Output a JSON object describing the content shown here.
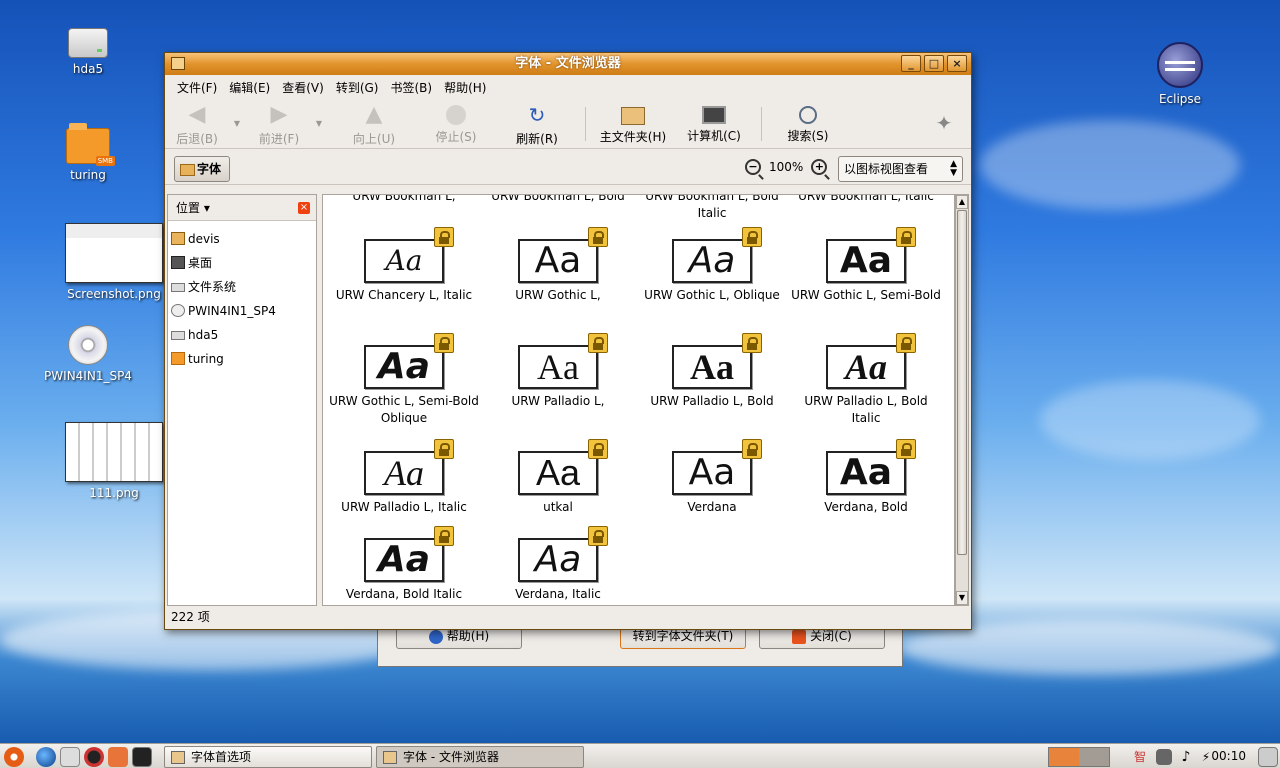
{
  "desktop": {
    "icons": [
      {
        "label": "hda5"
      },
      {
        "label": "turing",
        "badge": "SMB"
      },
      {
        "label": "Screenshot.png"
      },
      {
        "label": "PWIN4IN1_SP4"
      },
      {
        "label": "111.png"
      },
      {
        "label": "Eclipse"
      }
    ]
  },
  "background_dialog": {
    "help_label": "帮助(H)",
    "goto_label": "转到字体文件夹(T)",
    "close_label": "关闭(C)"
  },
  "window": {
    "title": "字体 - 文件浏览器",
    "controls": {
      "minimize": "_",
      "maximize": "□",
      "close": "×"
    },
    "menu": [
      "文件(F)",
      "编辑(E)",
      "查看(V)",
      "转到(G)",
      "书签(B)",
      "帮助(H)"
    ],
    "toolbar": {
      "back": "后退(B)",
      "forward": "前进(F)",
      "up": "向上(U)",
      "stop": "停止(S)",
      "reload": "刷新(R)",
      "home": "主文件夹(H)",
      "computer": "计算机(C)",
      "search": "搜索(S)"
    },
    "location": {
      "crumb": "字体",
      "zoom": "100%",
      "zoom_out": "−",
      "zoom_in": "+",
      "view_mode": "以图标视图查看"
    },
    "sidebar": {
      "header": "位置",
      "close": "×",
      "items": [
        "devis",
        "桌面",
        "文件系统",
        "PWIN4IN1_SP4",
        "hda5",
        "turing"
      ]
    },
    "top_row": [
      "URW Bookman L,",
      "URW Bookman L, Bold",
      "URW Bookman L, Bold Italic",
      "URW Bookman L, Italic"
    ],
    "fonts": [
      {
        "name": "URW Chancery L, Italic",
        "glyph": "Aa"
      },
      {
        "name": "URW Gothic L,",
        "glyph": "Aa"
      },
      {
        "name": "URW Gothic L, Oblique",
        "glyph": "Aa"
      },
      {
        "name": "URW Gothic L, Semi-Bold",
        "glyph": "Aa"
      },
      {
        "name": "URW Gothic L, Semi-Bold Oblique",
        "glyph": "Aa"
      },
      {
        "name": "URW Palladio L,",
        "glyph": "Aa"
      },
      {
        "name": "URW Palladio L, Bold",
        "glyph": "Aa"
      },
      {
        "name": "URW Palladio L, Bold Italic",
        "glyph": "Aa"
      },
      {
        "name": "URW Palladio L, Italic",
        "glyph": "Aa"
      },
      {
        "name": "utkal",
        "glyph": "Aa"
      },
      {
        "name": "Verdana",
        "glyph": "Aa"
      },
      {
        "name": "Verdana, Bold",
        "glyph": "Aa"
      },
      {
        "name": "Verdana, Bold Italic",
        "glyph": "Aa"
      },
      {
        "name": "Verdana, Italic",
        "glyph": "Aa"
      }
    ],
    "status": "222 项"
  },
  "taskbar": {
    "tasks": [
      "字体首选项",
      "字体 - 文件浏览器"
    ],
    "tray_ime": "智",
    "clock": "00:10"
  }
}
